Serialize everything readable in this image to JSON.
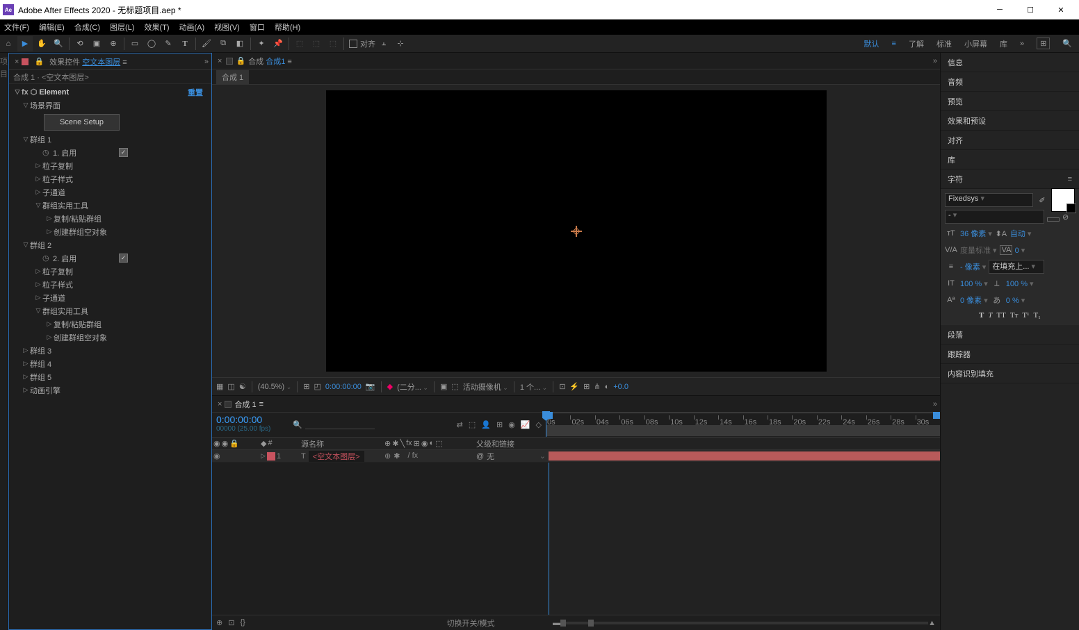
{
  "window": {
    "title": "Adobe After Effects 2020 - 无标题项目.aep *",
    "logo": "Ae"
  },
  "menu": [
    "文件(F)",
    "编辑(E)",
    "合成(C)",
    "图层(L)",
    "效果(T)",
    "动画(A)",
    "视图(V)",
    "窗口",
    "帮助(H)"
  ],
  "toolbar": {
    "snap_label": "对齐",
    "workspaces": [
      "默认",
      "了解",
      "标准",
      "小屏幕",
      "库"
    ],
    "active_ws": "默认"
  },
  "effects_panel": {
    "tab_prefix": "效果控件",
    "tab_link": "空文本图层",
    "sub": "合成 1 · <空文本图层>",
    "element_name": "Element",
    "reset": "重置",
    "scene_setup": "Scene Setup",
    "tree": {
      "scene_ui": "场景界面",
      "group1": "群组 1",
      "enable1": "1. 启用",
      "particle_replicator": "粒子复制",
      "particle_look": "粒子样式",
      "aux_channel": "子通道",
      "group_utils": "群组实用工具",
      "copy_paste": "复制/粘贴群组",
      "create_null": "创建群组空对象",
      "group2": "群组 2",
      "enable2": "2. 启用",
      "group3": "群组 3",
      "group4": "群组 4",
      "group5": "群组 5",
      "anim_engine": "动画引擎"
    }
  },
  "comp_panel": {
    "tab_prefix": "合成",
    "tab_comp": "合成1",
    "sub_comp": "合成 1",
    "zoom": "(40.5%)",
    "timecode": "0:00:00:00",
    "res": "(二分...",
    "camera": "活动摄像机",
    "views": "1 个...",
    "exposure": "+0.0"
  },
  "right_panels": [
    "信息",
    "音频",
    "预览",
    "效果和预设",
    "对齐",
    "库",
    "字符",
    "段落",
    "跟踪器",
    "内容识别填充"
  ],
  "character": {
    "font": "Fixedsys",
    "style": "-",
    "size": "36 像素",
    "leading": "自动",
    "kerning": "度量标准",
    "tracking": "0",
    "stroke": "- 像素",
    "stroke_pos": "在填充上...",
    "vscale": "100 %",
    "hscale": "100 %",
    "baseline": "0 像素",
    "tsume": "0 %"
  },
  "timeline": {
    "tab": "合成 1",
    "timecode": "0:00:00:00",
    "fps": "00000 (25.00 fps)",
    "col_source": "源名称",
    "col_parent": "父级和链接",
    "layer1_name": "<空文本图层>",
    "layer1_num": "1",
    "parent_none": "无",
    "toggle_label": "切换开关/模式",
    "ticks": [
      "0s",
      "02s",
      "04s",
      "06s",
      "08s",
      "10s",
      "12s",
      "14s",
      "16s",
      "18s",
      "20s",
      "22s",
      "24s",
      "26s",
      "28s",
      "30s"
    ]
  }
}
